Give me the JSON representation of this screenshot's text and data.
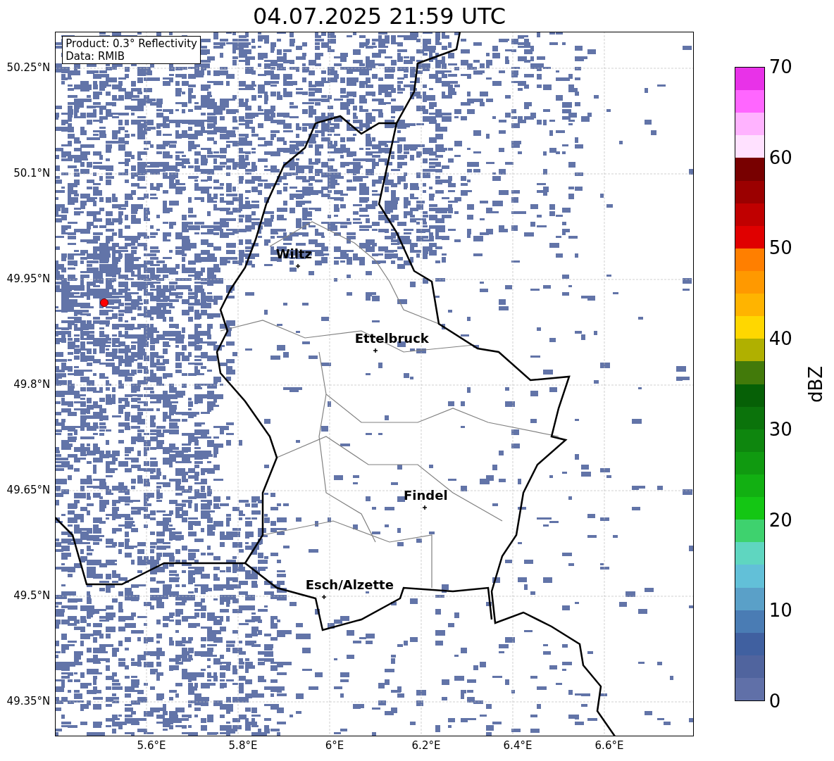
{
  "title": "04.07.2025 21:59 UTC",
  "info_box": {
    "lines": [
      "Product: 0.3° Reflectivity",
      "Data: RMIB"
    ]
  },
  "places": [
    {
      "name": "Wiltz"
    },
    {
      "name": "Ettelbruck"
    },
    {
      "name": "Findel"
    },
    {
      "name": "Esch/Alzette"
    }
  ],
  "y_ticks": [
    "50.25°N",
    "50.1°N",
    "49.95°N",
    "49.8°N",
    "49.65°N",
    "49.5°N",
    "49.35°N"
  ],
  "x_ticks": [
    "5.6°E",
    "5.8°E",
    "6°E",
    "6.2°E",
    "6.4°E",
    "6.6°E"
  ],
  "colorbar": {
    "label": "dBZ",
    "ticks": [
      "70",
      "60",
      "50",
      "40",
      "30",
      "20",
      "10",
      "0"
    ],
    "segments": [
      {
        "color": "#e832e8"
      },
      {
        "color": "#ff66ff"
      },
      {
        "color": "#ffb3ff"
      },
      {
        "color": "#ffe1ff"
      },
      {
        "color": "#780000"
      },
      {
        "color": "#9b0000"
      },
      {
        "color": "#c00000"
      },
      {
        "color": "#e00000"
      },
      {
        "color": "#ff7f00"
      },
      {
        "color": "#ff9900"
      },
      {
        "color": "#ffb400"
      },
      {
        "color": "#ffd700"
      },
      {
        "color": "#b0b000"
      },
      {
        "color": "#427a0a"
      },
      {
        "color": "#066006"
      },
      {
        "color": "#0b730b"
      },
      {
        "color": "#0e860e"
      },
      {
        "color": "#109a10"
      },
      {
        "color": "#12b012"
      },
      {
        "color": "#14c614"
      },
      {
        "color": "#3ed26e"
      },
      {
        "color": "#5fd6c0"
      },
      {
        "color": "#62c0d8"
      },
      {
        "color": "#5aa0c8"
      },
      {
        "color": "#4a7cb4"
      },
      {
        "color": "#4060a0"
      },
      {
        "color": "#50649e"
      },
      {
        "color": "#6070a8"
      }
    ]
  }
}
